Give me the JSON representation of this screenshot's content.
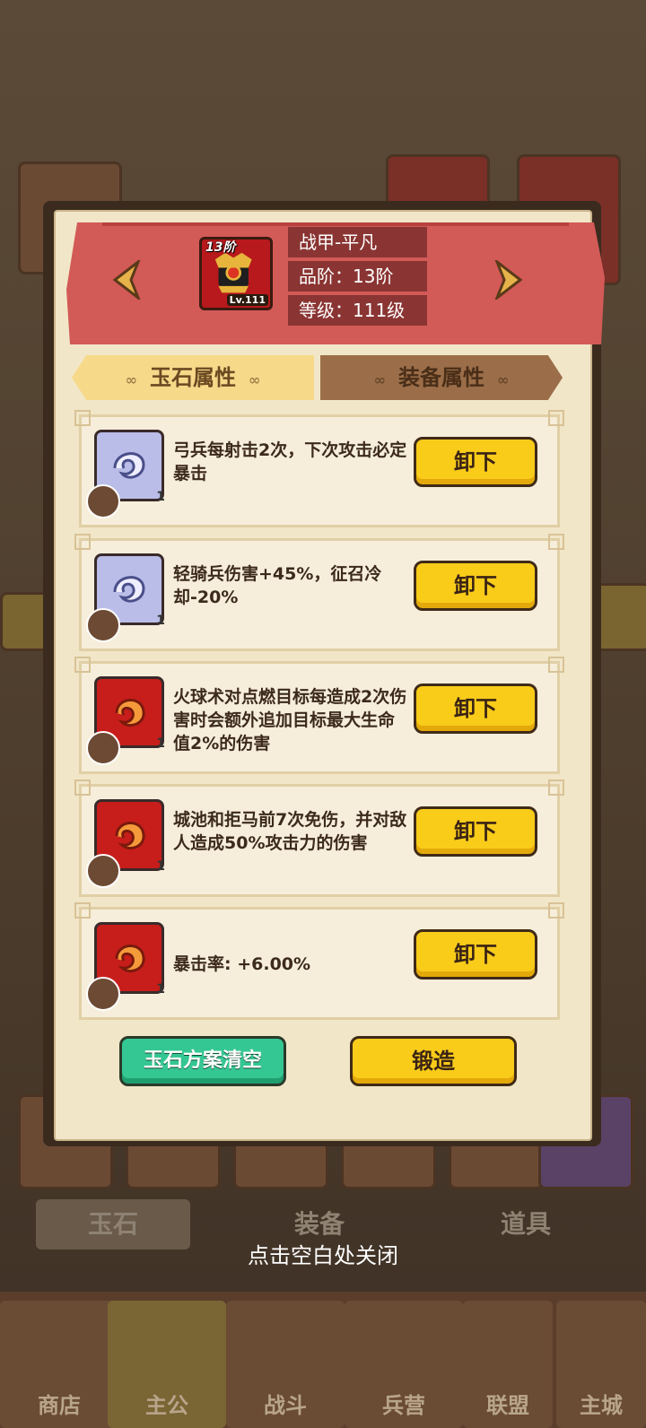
{
  "equipment": {
    "tier_badge": "13阶",
    "level_badge": "Lv.111",
    "name": "战甲-平凡",
    "grade": "品阶：13阶",
    "level": "等级：111级"
  },
  "tabs": {
    "jade": "玉石属性",
    "equip": "装备属性"
  },
  "jades": [
    {
      "color": "blue",
      "count": "1",
      "description": "弓兵每射击2次，下次攻击必定暴击",
      "button": "卸下"
    },
    {
      "color": "blue",
      "count": "1",
      "description": "轻骑兵伤害+45%，征召冷却-20%",
      "button": "卸下"
    },
    {
      "color": "red",
      "count": "1",
      "description": "火球术对点燃目标每造成2次伤害时会额外追加目标最大生命值2%的伤害",
      "button": "卸下"
    },
    {
      "color": "red",
      "count": "1",
      "description": "城池和拒马前7次免伤，并对敌人造成50%攻击力的伤害",
      "button": "卸下"
    },
    {
      "color": "red",
      "count": "1",
      "description": "暴击率: +6.00%",
      "button": "卸下"
    }
  ],
  "buttons": {
    "clear": "玉石方案清空",
    "forge": "锻造"
  },
  "close_hint": "点击空白处关闭",
  "background": {
    "segments": [
      "玉石",
      "装备",
      "道具"
    ],
    "nav": [
      "商店",
      "主公",
      "战斗",
      "兵营",
      "联盟",
      "主城"
    ]
  }
}
